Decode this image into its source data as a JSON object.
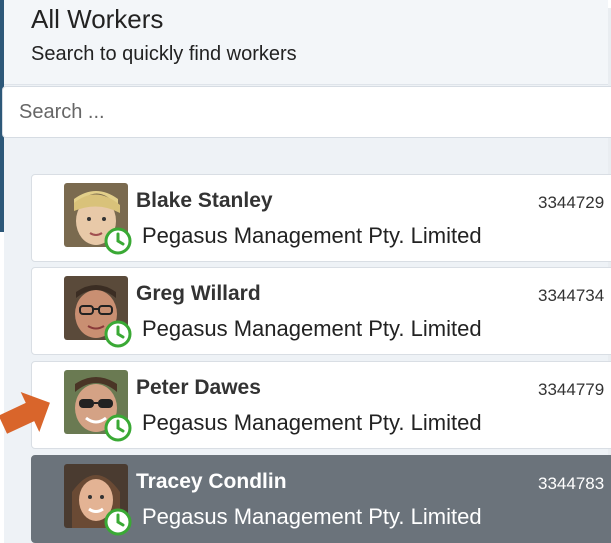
{
  "header": {
    "title": "All Workers",
    "subtitle": "Search to quickly find workers"
  },
  "search": {
    "placeholder": "Search ..."
  },
  "workers": [
    {
      "name": "Blake Stanley",
      "company": "Pegasus Management Pty. Limited",
      "id": "3344729",
      "selected": false
    },
    {
      "name": "Greg Willard",
      "company": "Pegasus Management Pty. Limited",
      "id": "3344734",
      "selected": false
    },
    {
      "name": "Peter Dawes",
      "company": "Pegasus Management Pty. Limited",
      "id": "3344779",
      "selected": false
    },
    {
      "name": "Tracey Condlin",
      "company": "Pegasus Management Pty. Limited",
      "id": "3344783",
      "selected": true
    }
  ],
  "colors": {
    "accent_arrow": "#d9652b",
    "clock_green": "#3aa935",
    "selected_bg": "#6b737b",
    "chrome_blue": "#2d5879"
  },
  "icons": [
    "clock-icon",
    "arrow-icon"
  ]
}
